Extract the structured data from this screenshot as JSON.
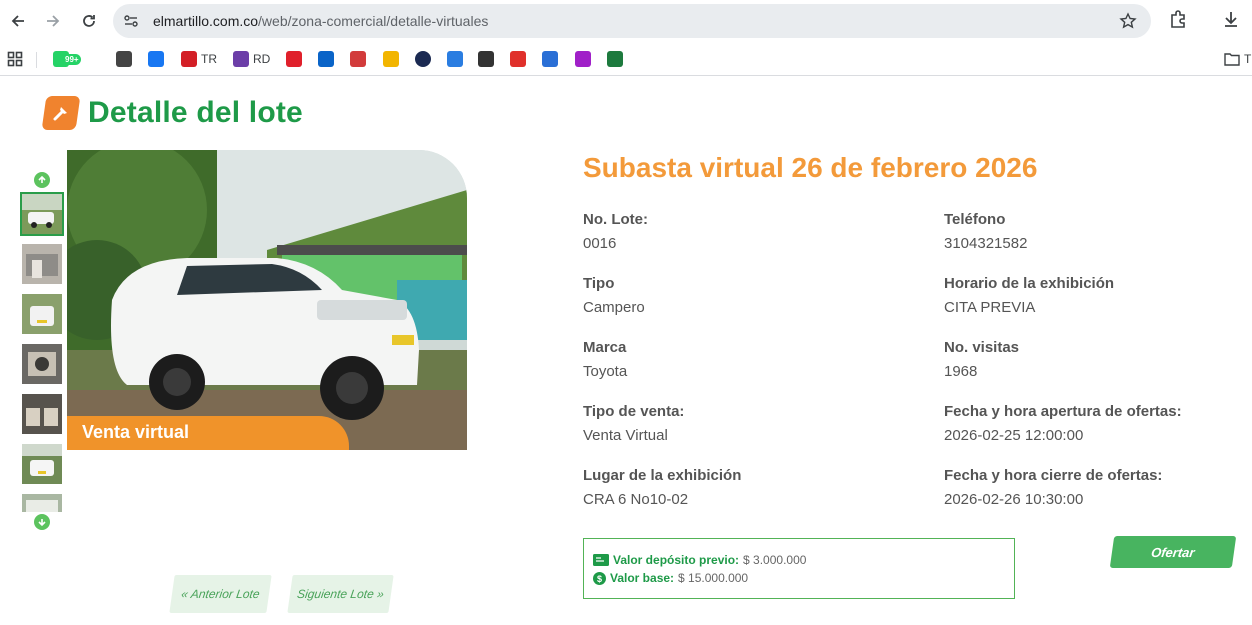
{
  "browser": {
    "url_host": "elmartillo.com.co",
    "url_path": "/web/zona-comercial/detalle-virtuales",
    "bookmarks": [
      {
        "icon": "whatsapp-icon",
        "label": "",
        "badge": "99+",
        "color": "#25d366"
      },
      {
        "icon": "openai-icon",
        "label": "",
        "color": "#444444"
      },
      {
        "icon": "facebook-icon",
        "label": "",
        "color": "#1877f2"
      },
      {
        "icon": "tr-icon",
        "label": "TR",
        "color": "#d31f26"
      },
      {
        "icon": "rd-icon",
        "label": "RD",
        "color": "#6c3ea8"
      },
      {
        "icon": "sa-icon",
        "label": "",
        "color": "#e0202b"
      },
      {
        "icon": "outlook-icon",
        "label": "",
        "color": "#0a64c8"
      },
      {
        "icon": "lc-icon",
        "label": "",
        "color": "#d23b3b"
      },
      {
        "icon": "puzzle-icon",
        "label": "",
        "color": "#f2b500"
      },
      {
        "icon": "circle-icon",
        "label": "",
        "color": "#1b2a52"
      },
      {
        "icon": "pin-icon",
        "label": "",
        "color": "#2a7de1"
      },
      {
        "icon": "m2-icon",
        "label": "",
        "color": "#333333"
      },
      {
        "icon": "diamond-icon",
        "label": "",
        "color": "#e0302b"
      },
      {
        "icon": "wave-icon",
        "label": "",
        "color": "#2a6fd6"
      },
      {
        "icon": "download-box-icon",
        "label": "",
        "color": "#a020c8"
      },
      {
        "icon": "excel-icon",
        "label": "",
        "color": "#1d7a3e"
      }
    ],
    "folder_label": "T"
  },
  "page": {
    "title": "Detalle del lote",
    "photo_label": "Venta virtual",
    "prev_label": "« Anterior Lote",
    "next_label": "Siguiente Lote »"
  },
  "lot": {
    "auction_title": "Subasta virtual 26 de febrero 2026",
    "fields_left": [
      {
        "label": "No. Lote:",
        "value": "0016"
      },
      {
        "label": "Tipo",
        "value": "Campero"
      },
      {
        "label": "Marca",
        "value": "Toyota"
      },
      {
        "label": "Tipo de venta:",
        "value": "Venta Virtual"
      },
      {
        "label": "Lugar de la exhibición",
        "value": "CRA 6 No10-02"
      }
    ],
    "fields_right": [
      {
        "label": "Teléfono",
        "value": "3104321582"
      },
      {
        "label": "Horario de la exhibición",
        "value": "CITA PREVIA"
      },
      {
        "label": "No. visitas",
        "value": "1968"
      },
      {
        "label": "Fecha y hora apertura de ofertas:",
        "value": "2026-02-25 12:00:00"
      },
      {
        "label": "Fecha y hora cierre de ofertas:",
        "value": "2026-02-26 10:30:00"
      }
    ],
    "deposit_label": "Valor depósito previo:",
    "deposit_value": "$ 3.000.000",
    "base_label": "Valor base:",
    "base_value": "$ 15.000.000",
    "offer_label": "Ofertar"
  },
  "colors": {
    "brand_green": "#1e9a48",
    "brand_orange": "#f39a3a",
    "accent_button": "#48b460"
  }
}
